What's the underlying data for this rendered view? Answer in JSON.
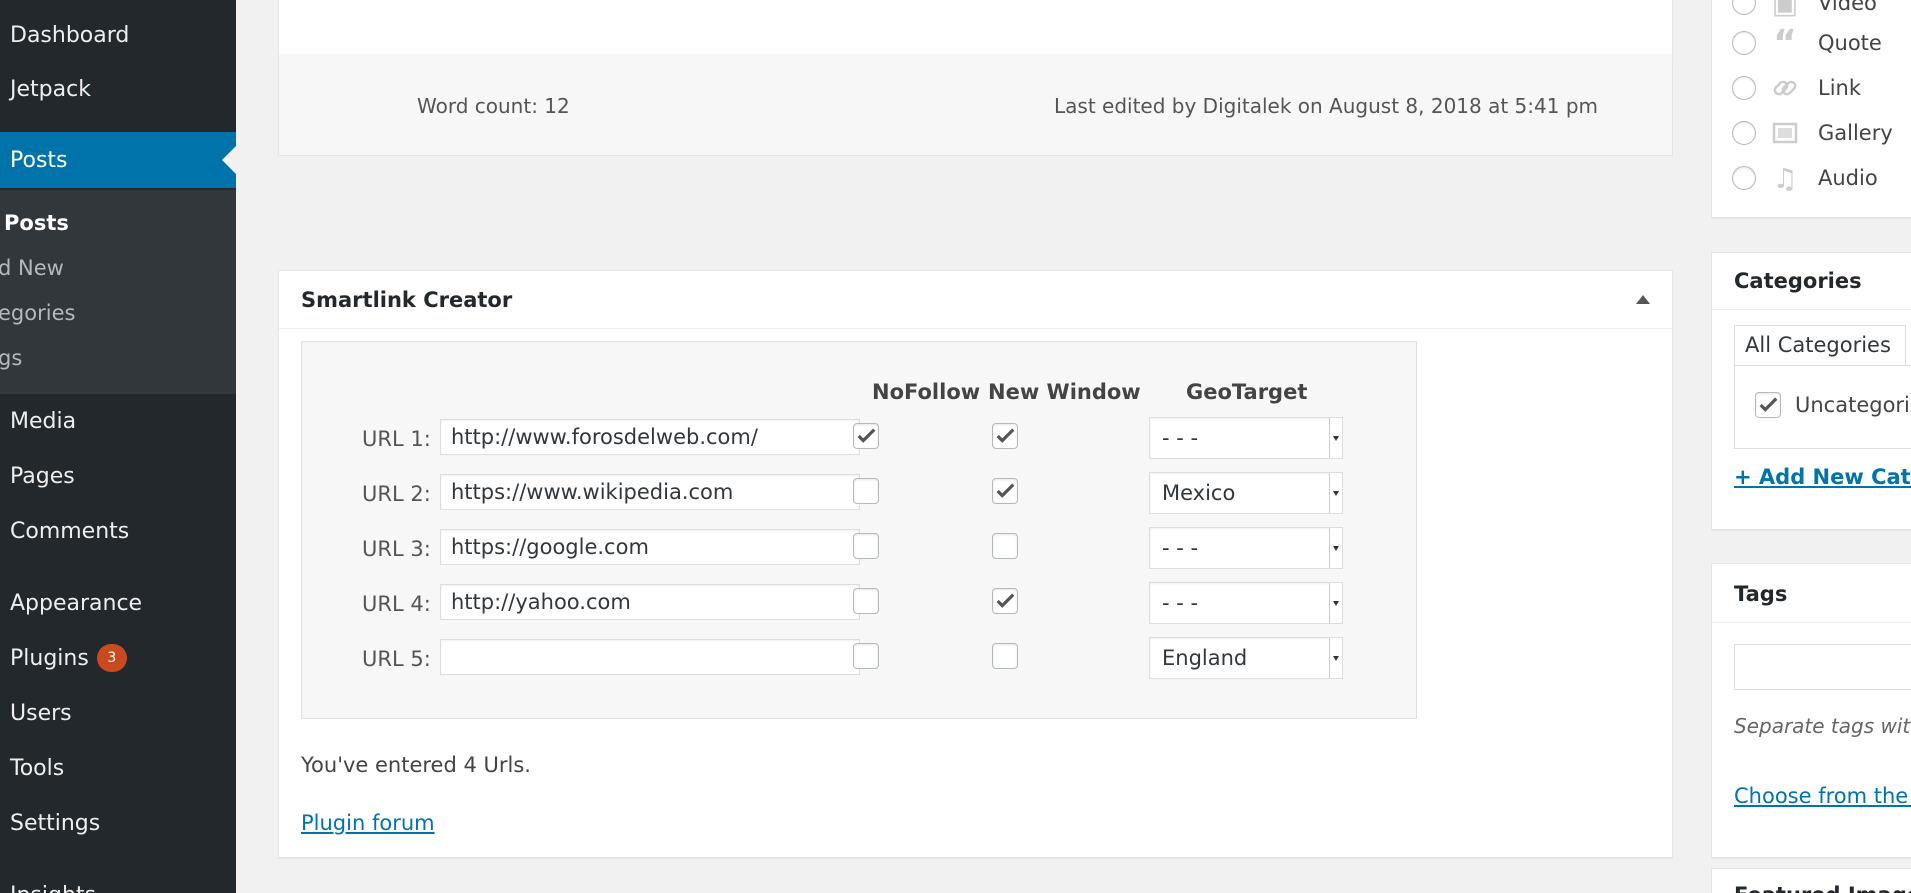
{
  "sidebar": {
    "menu": [
      {
        "label": "Dashboard"
      },
      {
        "label": "Jetpack"
      },
      {
        "label": "Posts"
      },
      {
        "label": "Media"
      },
      {
        "label": "Pages"
      },
      {
        "label": "Comments"
      },
      {
        "label": "Appearance"
      },
      {
        "label": "Plugins",
        "badge": "3"
      },
      {
        "label": "Users"
      },
      {
        "label": "Tools"
      },
      {
        "label": "Settings"
      },
      {
        "label": "Insights"
      }
    ],
    "submenu": [
      {
        "label": "Posts"
      },
      {
        "label": "d New"
      },
      {
        "label": "egories"
      },
      {
        "label": "gs"
      }
    ]
  },
  "status": {
    "word_count": "Word count: 12",
    "last_edited": "Last edited by Digitalek on August 8, 2018 at 5:41 pm"
  },
  "smartlink": {
    "title": "Smartlink Creator",
    "headers": {
      "nofollow": "NoFollow",
      "new_window": "New Window",
      "geotarget": "GeoTarget"
    },
    "rows": [
      {
        "label": "URL 1:",
        "value": "http://www.forosdelweb.com/",
        "nofollow": true,
        "new_window": true,
        "geo": "- - -"
      },
      {
        "label": "URL 2:",
        "value": "https://www.wikipedia.com",
        "nofollow": false,
        "new_window": true,
        "geo": "Mexico"
      },
      {
        "label": "URL 3:",
        "value": "https://google.com",
        "nofollow": false,
        "new_window": false,
        "geo": "- - -"
      },
      {
        "label": "URL 4:",
        "value": "http://yahoo.com",
        "nofollow": false,
        "new_window": true,
        "geo": "- - -"
      },
      {
        "label": "URL 5:",
        "value": "",
        "nofollow": false,
        "new_window": false,
        "geo": "England"
      }
    ],
    "entered": "You've entered 4 Urls.",
    "forum_link": "Plugin forum"
  },
  "format": {
    "options": [
      {
        "label": "Video",
        "icon": "video-icon"
      },
      {
        "label": "Quote",
        "icon": "quote-icon"
      },
      {
        "label": "Link",
        "icon": "link-icon"
      },
      {
        "label": "Gallery",
        "icon": "gallery-icon"
      },
      {
        "label": "Audio",
        "icon": "audio-icon"
      }
    ]
  },
  "categories": {
    "title": "Categories",
    "tab_all": "All Categories",
    "item": "Uncategorized",
    "add_new": "+ Add New Category"
  },
  "tags": {
    "title": "Tags",
    "hint": "Separate tags with commas",
    "choose": "Choose from the most used tags"
  },
  "featured": {
    "title": "Featured Image"
  },
  "colors": {
    "sidebar_bg": "#23282d",
    "active_bg": "#0073aa",
    "badge": "#ca4a1f",
    "link": "#0073aa"
  }
}
